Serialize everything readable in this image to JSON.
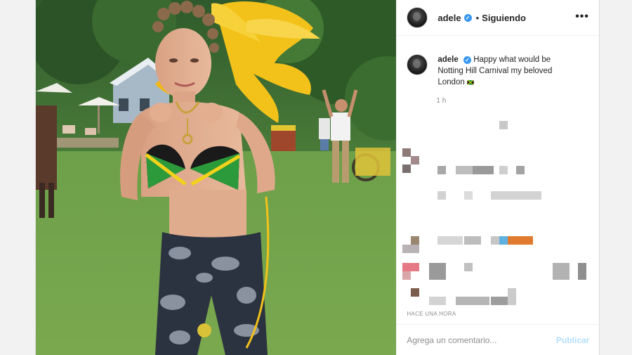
{
  "post": {
    "username": "adele",
    "verified_icon": "verified-badge-icon",
    "separator": "•",
    "follow_status": "Siguiendo",
    "more_icon": "more-options-icon",
    "caption": {
      "username": "adele",
      "text": "Happy what would be Notting Hill Carnival my beloved London",
      "flag": "🇯🇲"
    },
    "caption_time": "1 h",
    "timestamp": "HACE UNA HORA",
    "comment_placeholder": "Agrega un comentario...",
    "publish_label": "Publicar"
  },
  "colors": {
    "accent": "#3897f0",
    "publish_disabled": "#b2dffc",
    "text": "#262626",
    "muted": "#8e8e8e"
  }
}
